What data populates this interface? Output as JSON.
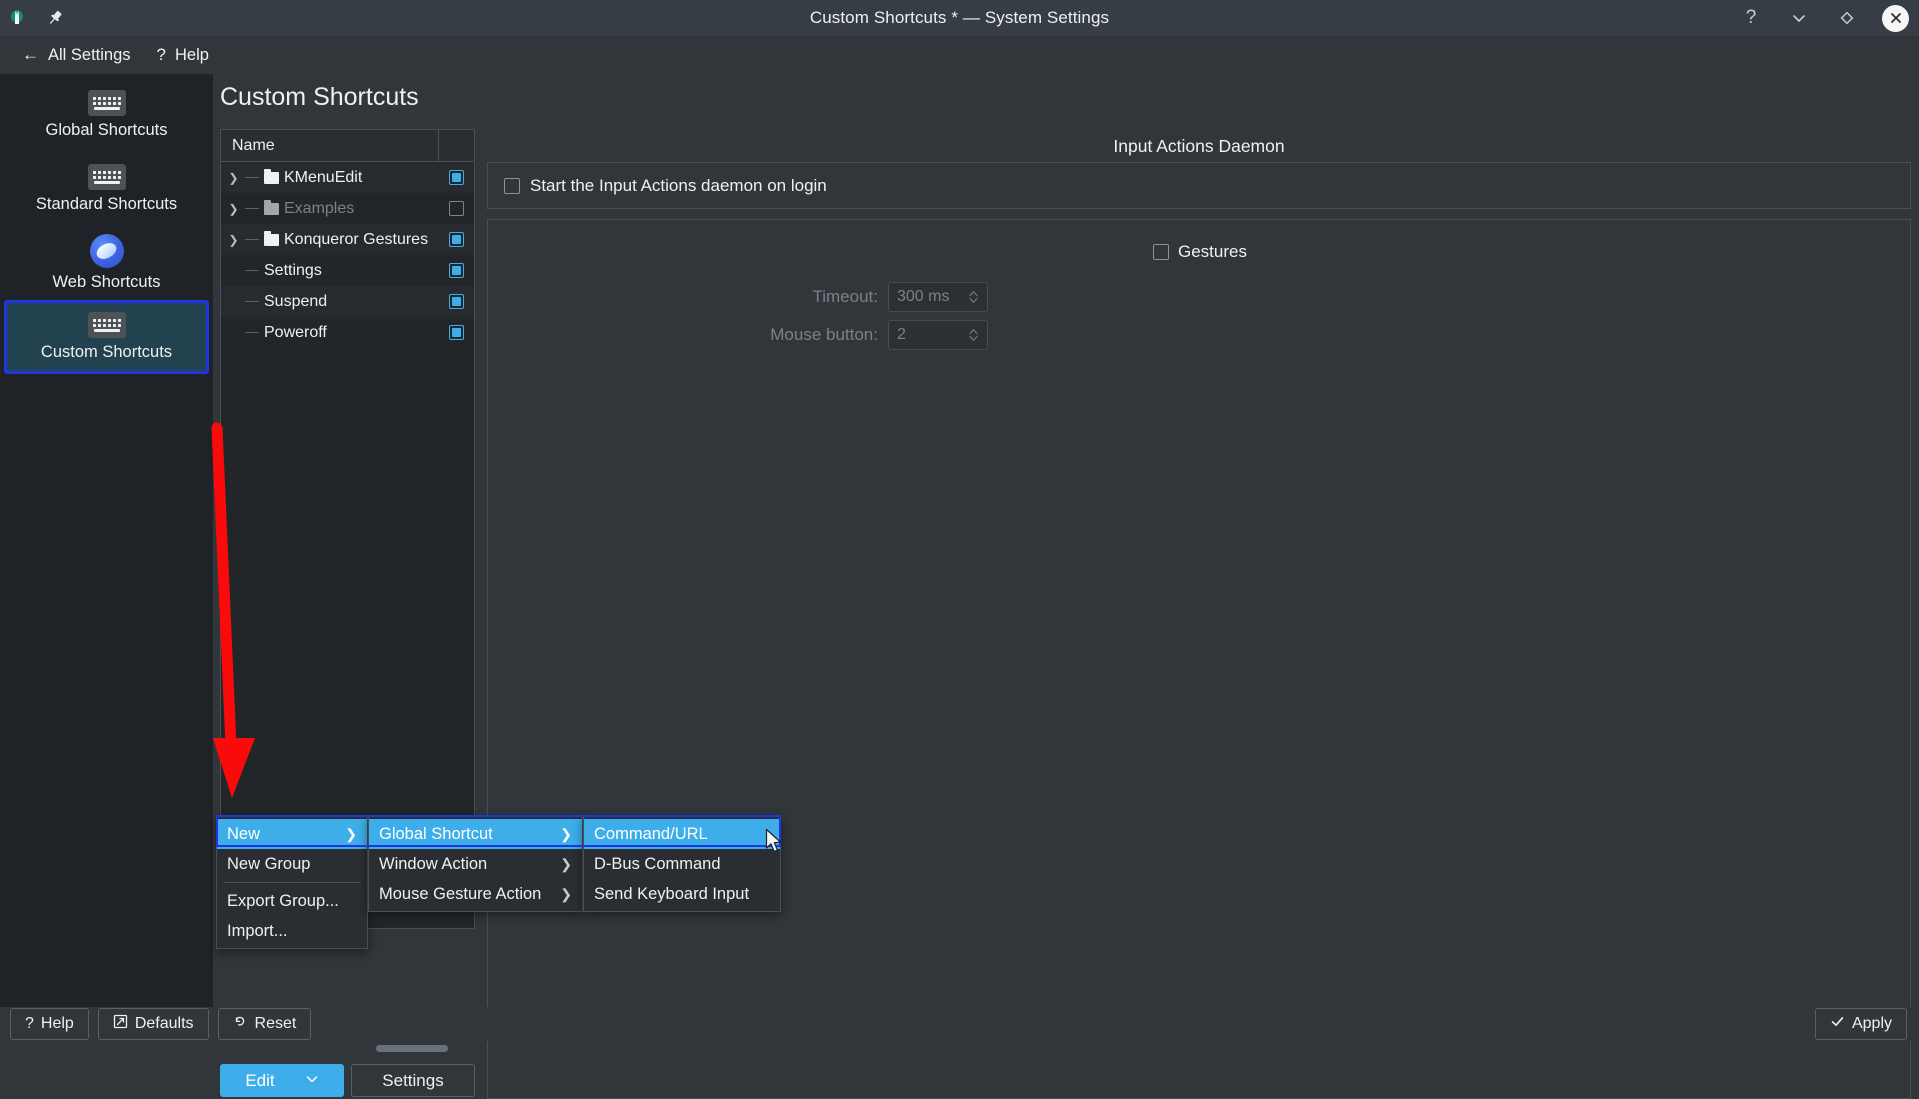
{
  "window": {
    "title": "Custom Shortcuts * — System Settings",
    "app_icon": "wrench-icon",
    "pin_icon": "pin-icon",
    "controls": {
      "help": "?",
      "minimize": "⌄",
      "maximize": "◇",
      "close": "✕"
    }
  },
  "toolbar": {
    "back_label": "All Settings",
    "back_icon": "arrow-left-icon",
    "help_label": "Help",
    "help_icon": "question-mark-icon"
  },
  "sidebar": {
    "items": [
      {
        "label": "Global Shortcuts",
        "icon": "keyboard-icon",
        "selected": false
      },
      {
        "label": "Standard Shortcuts",
        "icon": "keyboard-icon",
        "selected": false
      },
      {
        "label": "Web Shortcuts",
        "icon": "globe-icon",
        "selected": false
      },
      {
        "label": "Custom Shortcuts",
        "icon": "keyboard-icon",
        "selected": true
      }
    ]
  },
  "page": {
    "title": "Custom Shortcuts"
  },
  "tree": {
    "columns": [
      "Name",
      ""
    ],
    "rows": [
      {
        "name": "KMenuEdit",
        "expandable": true,
        "icon": "folder-icon",
        "checked": true,
        "dim": false,
        "alt": true
      },
      {
        "name": "Examples",
        "expandable": true,
        "icon": "folder-icon",
        "checked": false,
        "dim": true,
        "alt": false
      },
      {
        "name": "Konqueror Gestures",
        "expandable": true,
        "icon": "folder-icon",
        "checked": true,
        "dim": false,
        "alt": true
      },
      {
        "name": "Settings",
        "expandable": false,
        "icon": "",
        "checked": true,
        "dim": false,
        "alt": false
      },
      {
        "name": "Suspend",
        "expandable": false,
        "icon": "",
        "checked": true,
        "dim": false,
        "alt": true
      },
      {
        "name": "Poweroff",
        "expandable": false,
        "icon": "",
        "checked": true,
        "dim": false,
        "alt": false
      }
    ],
    "edit_button": "Edit",
    "edit_chevron": "chevron-down-icon",
    "settings_button": "Settings"
  },
  "right_panel": {
    "daemon_title": "Input Actions Daemon",
    "daemon_checkbox_label": "Start the Input Actions daemon on login",
    "daemon_checked": false,
    "gestures_label": "Gestures",
    "gestures_checked": false,
    "timeout_label": "Timeout:",
    "timeout_value": "300 ms",
    "mouse_button_label": "Mouse button:",
    "mouse_button_value": "2"
  },
  "context_menu": {
    "level1": [
      {
        "label": "New",
        "submenu": true,
        "selected": true
      },
      {
        "label": "New Group",
        "submenu": false,
        "selected": false
      },
      {
        "separator_after": true
      },
      {
        "label": "Export Group...",
        "submenu": false,
        "selected": false
      },
      {
        "label": "Import...",
        "submenu": false,
        "selected": false
      }
    ],
    "level2": [
      {
        "label": "Global Shortcut",
        "submenu": true,
        "selected": true
      },
      {
        "label": "Window Action",
        "submenu": true,
        "selected": false
      },
      {
        "label": "Mouse Gesture Action",
        "submenu": true,
        "selected": false
      }
    ],
    "level3": [
      {
        "label": "Command/URL",
        "submenu": false,
        "selected": true
      },
      {
        "label": "D-Bus Command",
        "submenu": false,
        "selected": false
      },
      {
        "label": "Send Keyboard Input",
        "submenu": false,
        "selected": false
      }
    ]
  },
  "bottom_bar": {
    "help_label": "Help",
    "help_icon": "question-mark-icon",
    "defaults_label": "Defaults",
    "defaults_icon": "restore-icon",
    "reset_label": "Reset",
    "reset_icon": "undo-icon",
    "apply_label": "Apply",
    "apply_icon": "check-icon"
  },
  "annotation": {
    "arrow_color": "#fa0a0a",
    "arrow_name": "red-pointer-arrow"
  },
  "colors": {
    "accent": "#3daee9",
    "focus_ring": "#1f35de",
    "window_bg": "#31363b",
    "sidebar_bg": "#1f2327",
    "panel_bg": "#232629",
    "selected_sidebar_bg": "#22424f"
  }
}
